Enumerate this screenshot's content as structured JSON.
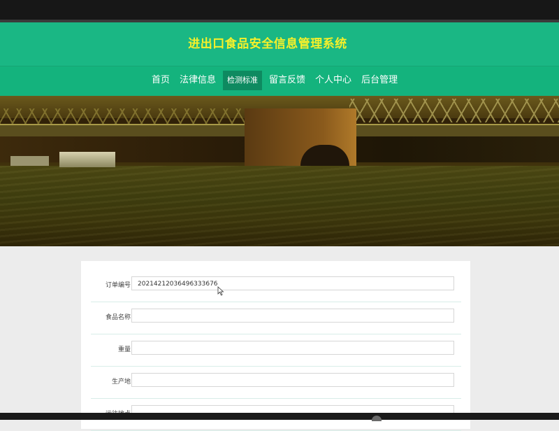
{
  "header": {
    "title": "进出口食品安全信息管理系统",
    "title_color": "#f6f02a",
    "background_color": "#1ab784"
  },
  "nav": {
    "items": [
      {
        "label": "首页",
        "active": false
      },
      {
        "label": "法律信息",
        "active": false
      },
      {
        "label": "检测标准",
        "active": true
      },
      {
        "label": "留言反馈",
        "active": false
      },
      {
        "label": "个人中心",
        "active": false
      },
      {
        "label": "后台管理",
        "active": false
      }
    ],
    "active_color": "#0e8a60"
  },
  "banner": {
    "image": "bridge-over-river-photo"
  },
  "form": {
    "fields": [
      {
        "label": "订单编号：",
        "value": "20214212036496333676",
        "placeholder": ""
      },
      {
        "label": "食品名称：",
        "value": "",
        "placeholder": ""
      },
      {
        "label": "重量：",
        "value": "",
        "placeholder": ""
      },
      {
        "label": "生产地：",
        "value": "",
        "placeholder": ""
      },
      {
        "label": "运往地点：",
        "value": "",
        "placeholder": ""
      }
    ]
  }
}
